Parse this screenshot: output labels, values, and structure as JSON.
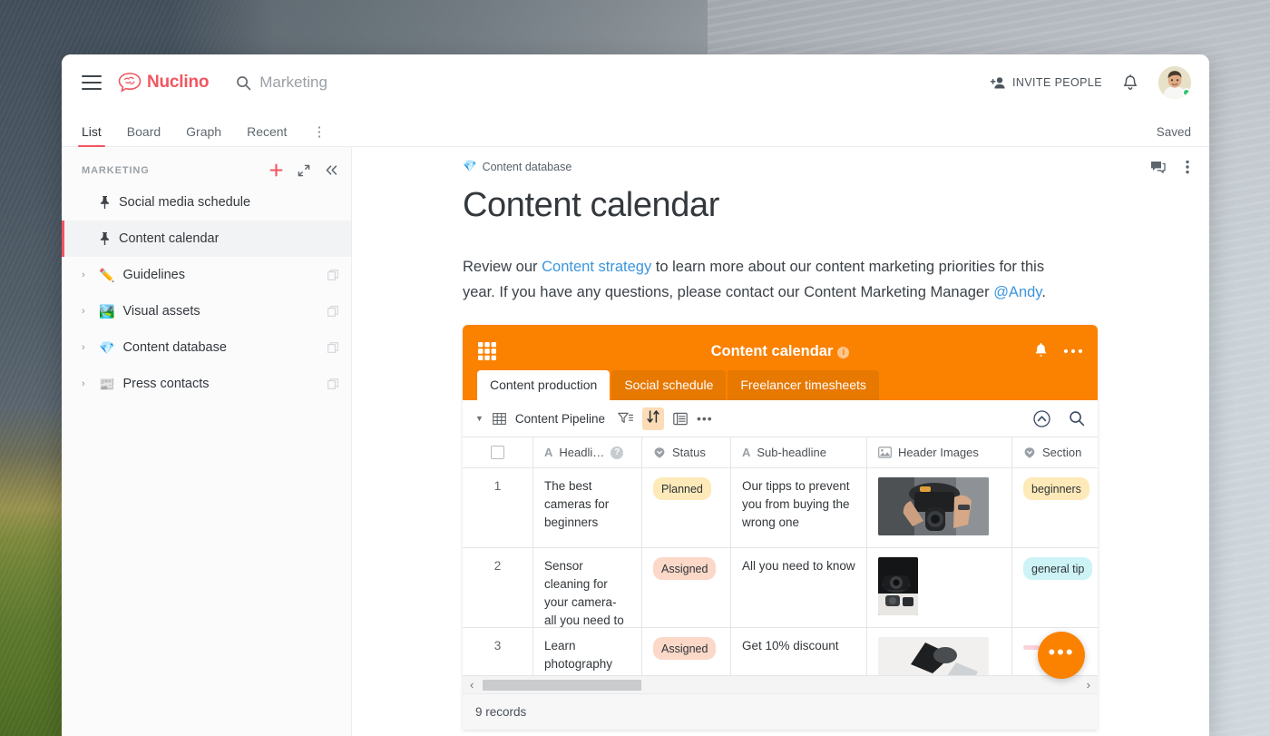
{
  "window": {
    "topbar": {
      "menu_icon": "hamburger-icon",
      "brand": "Nuclino",
      "search_icon": "search-icon",
      "search_value": "Marketing",
      "invite_label": "INVITE PEOPLE",
      "invite_icon": "add-person-icon",
      "bell_icon": "bell-icon",
      "avatar_icon": "user-avatar"
    },
    "tabs": [
      {
        "label": "List",
        "active": true
      },
      {
        "label": "Board",
        "active": false
      },
      {
        "label": "Graph",
        "active": false
      },
      {
        "label": "Recent",
        "active": false
      }
    ],
    "tabs_more": "⋮",
    "save_status": "Saved"
  },
  "sidebar": {
    "title": "MARKETING",
    "actions": [
      {
        "name": "add-icon",
        "glyph": "+"
      },
      {
        "name": "expand-icon",
        "glyph": "⤢"
      },
      {
        "name": "collapse-sidebar-icon",
        "glyph": "«"
      }
    ],
    "items": [
      {
        "label": "Social media schedule",
        "icon": "pin-icon",
        "emoji": "",
        "expandable": false,
        "selected": false,
        "duplicate": false
      },
      {
        "label": "Content calendar",
        "icon": "pin-icon",
        "emoji": "",
        "expandable": false,
        "selected": true,
        "duplicate": false
      },
      {
        "label": "Guidelines",
        "icon": "emoji",
        "emoji": "✏️",
        "expandable": true,
        "selected": false,
        "duplicate": true
      },
      {
        "label": "Visual assets",
        "icon": "emoji",
        "emoji": "🏞️",
        "expandable": true,
        "selected": false,
        "duplicate": true
      },
      {
        "label": "Content database",
        "icon": "emoji",
        "emoji": "💎",
        "expandable": true,
        "selected": false,
        "duplicate": true
      },
      {
        "label": "Press contacts",
        "icon": "emoji",
        "emoji": "📰",
        "expandable": true,
        "selected": false,
        "duplicate": true
      }
    ]
  },
  "document": {
    "tools": [
      {
        "name": "comment-icon"
      },
      {
        "name": "more-options-icon",
        "glyph": "⋮"
      }
    ],
    "breadcrumb_emoji": "💎",
    "breadcrumb": "Content database",
    "title": "Content calendar",
    "paragraph": {
      "part1": "Review our ",
      "link": "Content strategy",
      "part2": " to learn more about our content marketing priorities for this year. If you have any questions, please contact our Content Marketing Manager ",
      "mention": "@Andy",
      "part3": "."
    }
  },
  "embed": {
    "brand_color": "#fb8100",
    "grid_icon": "app-grid-icon",
    "title": "Content calendar",
    "info_glyph": "i",
    "bell_icon": "bell-icon",
    "more_icon": "more-horizontal-icon",
    "tabs": [
      {
        "label": "Content production",
        "active": true
      },
      {
        "label": "Social schedule",
        "active": false
      },
      {
        "label": "Freelancer timesheets",
        "active": false
      }
    ],
    "view_bar": {
      "caret": "▼",
      "grid_icon": "table-view-icon",
      "view_name": "Content Pipeline",
      "filter_icon": "filter-icon",
      "sort_icon": "sort-icon",
      "row_height_icon": "row-height-icon",
      "more_glyph": "•••",
      "collapse_icon": "collapse-up-icon",
      "search_icon": "search-icon"
    },
    "table": {
      "columns": [
        {
          "label": "",
          "type": "checkbox",
          "name": "select-all-checkbox"
        },
        {
          "label": "Headli…",
          "type": "text",
          "help": "?"
        },
        {
          "label": "Status",
          "type": "select"
        },
        {
          "label": "Sub-headline",
          "type": "text"
        },
        {
          "label": "Header Images",
          "type": "attachment"
        },
        {
          "label": "Section",
          "type": "select"
        }
      ],
      "rows": [
        {
          "num": "1",
          "headline": "The best cameras for beginners",
          "status": "Planned",
          "status_color": "#fdeab8",
          "subheadline": "Our tipps to prevent you from buying the wrong one",
          "image": "camera-in-hands-photo",
          "section": "beginners",
          "section_color": "#fdeab8"
        },
        {
          "num": "2",
          "headline": "Sensor cleaning for your camera- all you need to know",
          "status": "Assigned",
          "status_color": "#fbd8c8",
          "subheadline": "All you need to know",
          "image": "camera-gear-photo",
          "section": "general tip",
          "section_color": "#cdf3f6"
        },
        {
          "num": "3",
          "headline": "Learn photography",
          "status": "Assigned",
          "status_color": "#fbd8c8",
          "subheadline": "Get 10% discount",
          "image": "camera-lens-photo",
          "section": "",
          "section_color": "#fcd2da"
        }
      ]
    },
    "scroll": {
      "left_arrow": "‹",
      "right_arrow": "›"
    },
    "records_label": "9 records",
    "fab_glyph": "•••"
  }
}
